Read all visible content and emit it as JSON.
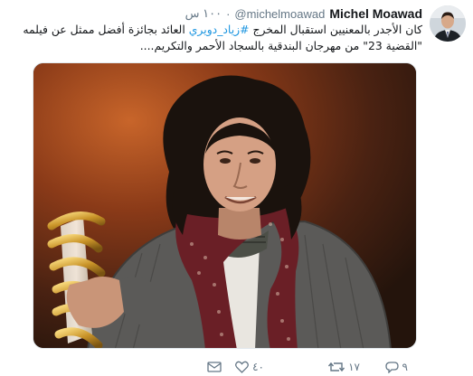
{
  "tweet": {
    "author_name": "Michel Moawad",
    "author_handle": "@michelmoawad",
    "dot": "·",
    "time": "١٠٠ س",
    "text_before_hashtag": "كان الأجدر بالمعنيين استقبال المخرج ",
    "hashtag": "#زياد_دويري",
    "text_after_hashtag": " العائد بجائزة أفضل ممثل عن فيلمه \"القضية 23\" من مهرجان البندقية بالسجاد الأحمر والتكريم....",
    "image_alt": "Director holding golden award trophy"
  },
  "actions": {
    "reply_count": "٩",
    "retweet_count": "١٧",
    "like_count": "٤٠",
    "dm_label": ""
  },
  "icons": {
    "reply": "reply-icon",
    "retweet": "retweet-icon",
    "like": "heart-icon",
    "dm": "envelope-icon"
  },
  "colors": {
    "hashtag": "#1b95e0",
    "secondary_text": "#657786",
    "primary_text": "#14171a"
  }
}
